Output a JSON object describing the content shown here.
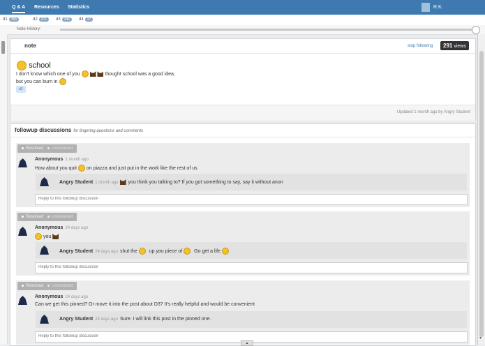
{
  "nav": {
    "tabs": [
      "Q & A",
      "Resources",
      "Statistics"
    ],
    "user": "R.K."
  },
  "folders": [
    {
      "label": "d1",
      "count": "366"
    },
    {
      "label": "d2",
      "count": "271"
    },
    {
      "label": "d3",
      "count": "346"
    },
    {
      "label": "d4",
      "count": "37"
    }
  ],
  "history": {
    "label": "Note History:"
  },
  "note": {
    "header": "note",
    "stop_following": "stop following",
    "views_count": "291",
    "views_label": "views",
    "title": "school",
    "line1_a": "I don't know which one of you",
    "line1_b": "thought school was a good idea,",
    "line2_a": "but you can burn in",
    "tag": "d3",
    "updated": "Updated 1 month ago by Angry Student"
  },
  "followups": {
    "title": "followup discussions",
    "subtitle": "for lingering questions and comments",
    "resolved": "Resolved",
    "unresolved": "Unresolved",
    "reply_placeholder": "Reply to this followup discussion",
    "items": [
      {
        "author": "Anonymous",
        "time": "1 month ago",
        "msg_a": "How about you quit",
        "msg_b": "on piazza and just put in the work like the rest of us",
        "reply_author": "Angry Student",
        "reply_time": "1 month ago",
        "reply_text": "you think you talking to? If you got something to say, say it without anon"
      },
      {
        "author": "Anonymous",
        "time": "24 days ago",
        "msg_a": "you",
        "reply_author": "Angry Student",
        "reply_time": "24 days ago",
        "reply_a": "shut the",
        "reply_b": "up you piece of",
        "reply_c": "Go get a life"
      },
      {
        "author": "Anonymous",
        "time": "24 days ago",
        "msg_a": "Can we get this pinned? Or move it into the post about D3? It's really helpful and would be convenient",
        "reply_author": "Angry Student",
        "reply_time": "24 days ago",
        "reply_text": "Sure. I will link this post in the pinned one."
      }
    ]
  }
}
